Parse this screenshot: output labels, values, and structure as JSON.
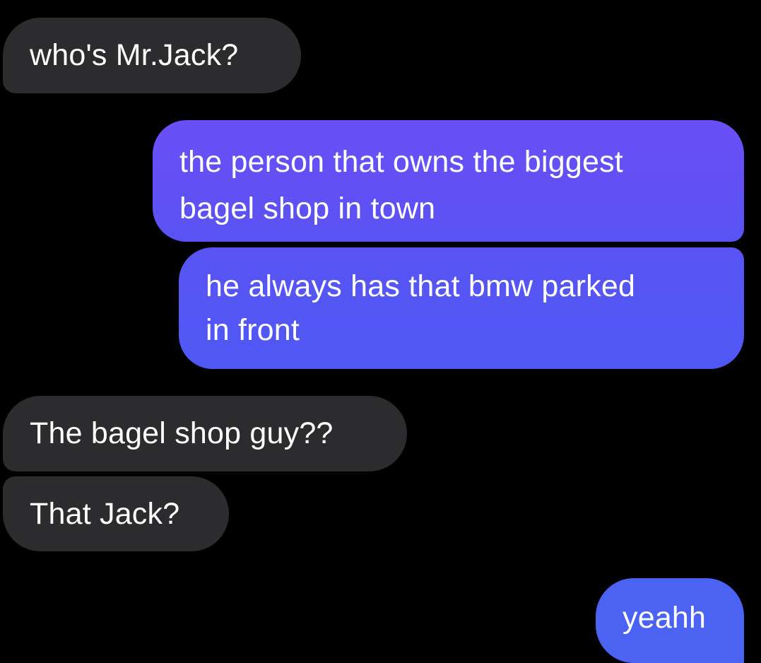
{
  "conversation": {
    "messages": [
      {
        "sender": "them",
        "lines": [
          "who's Mr.Jack?"
        ]
      },
      {
        "sender": "me",
        "lines": [
          "the person that owns the biggest",
          "bagel shop in town"
        ]
      },
      {
        "sender": "me",
        "lines": [
          "he always has that bmw parked",
          "in front"
        ]
      },
      {
        "sender": "them",
        "lines": [
          "The bagel shop guy??"
        ]
      },
      {
        "sender": "them",
        "lines": [
          "That Jack?"
        ]
      },
      {
        "sender": "me",
        "lines": [
          "yeahh"
        ]
      }
    ]
  },
  "colors": {
    "background": "#000000",
    "incoming_bubble": "#2c2c2e",
    "outgoing_bubble_top": "#6a4ff6",
    "outgoing_bubble_bottom": "#4b62f2",
    "text": "#ffffff"
  }
}
